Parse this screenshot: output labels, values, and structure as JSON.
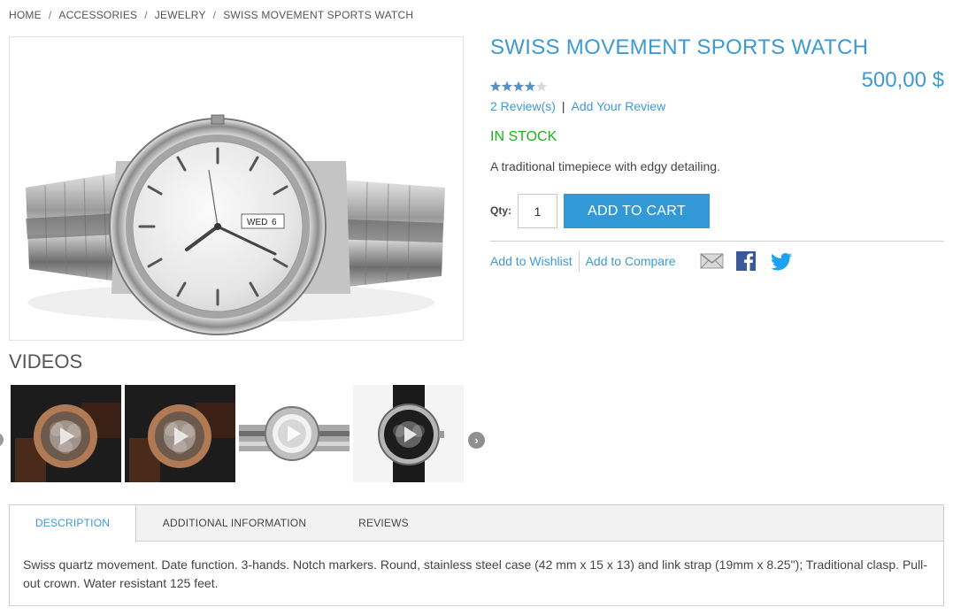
{
  "breadcrumb": {
    "items": [
      "HOME",
      "ACCESSORIES",
      "JEWELRY",
      "SWISS MOVEMENT SPORTS WATCH"
    ],
    "separator": "/"
  },
  "product": {
    "title": "SWISS MOVEMENT SPORTS WATCH",
    "price": "500,00 $",
    "rating": {
      "value": 4,
      "max": 5
    },
    "reviews_link": "2 Review(s)",
    "review_divider": "|",
    "add_review_link": "Add Your Review",
    "stock_status": "IN STOCK",
    "short_description": "A traditional timepiece with edgy detailing.",
    "watch_date_window": "WED",
    "watch_day_window": "6"
  },
  "cart": {
    "qty_label": "Qty:",
    "qty_value": "1",
    "add_to_cart_label": "ADD TO CART"
  },
  "actions": {
    "wishlist": "Add to Wishlist",
    "compare": "Add to Compare",
    "icons": [
      "email-icon",
      "facebook-icon",
      "twitter-icon"
    ]
  },
  "videos": {
    "title": "VIDEOS",
    "thumbnails": [
      "video-thumbnail-rose-gold-chronograph",
      "video-thumbnail-rose-gold-chronograph",
      "video-thumbnail-steel-watch",
      "video-thumbnail-black-leather-chronograph"
    ],
    "next_icon": "chevron-right-icon"
  },
  "tabs": {
    "items": [
      "DESCRIPTION",
      "ADDITIONAL INFORMATION",
      "REVIEWS"
    ],
    "active": "DESCRIPTION",
    "description_text": "Swiss quartz movement. Date function. 3-hands. Notch markers. Round, stainless steel case (42 mm x 15 x 13) and link strap (19mm x 8.25\"); Traditional clasp. Pull-out crown. Water resistant 125 feet."
  },
  "colors": {
    "accent": "#3d9ad1",
    "button": "#3399d6",
    "in_stock": "#18b418",
    "facebook": "#3b5998",
    "twitter": "#1da1f2",
    "star_filled": "#5a8fc0",
    "star_empty": "#d8d8d8"
  }
}
